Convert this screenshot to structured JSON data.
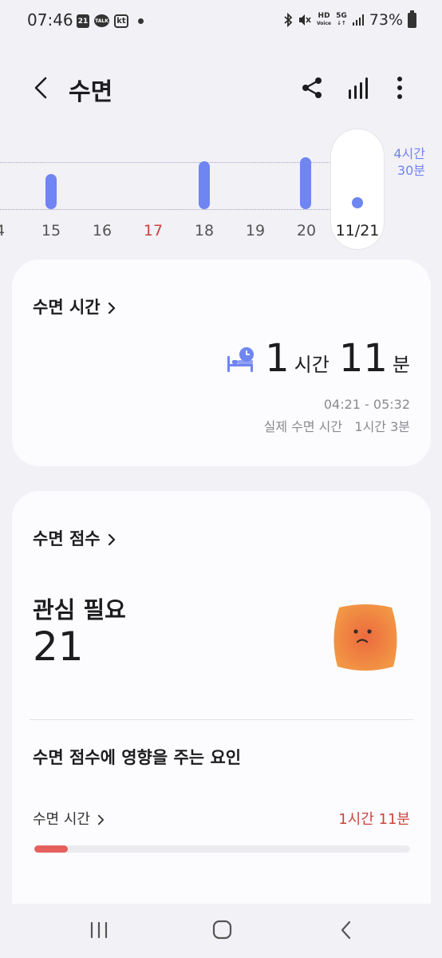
{
  "status_bar": {
    "time": "07:46",
    "calendar_badge": "21",
    "talk_badge": "TALK",
    "kt_badge": "kt",
    "hd_label": "HD",
    "voice_label": "Voice",
    "network": "5G",
    "battery": "73%",
    "icons": [
      "bluetooth-icon",
      "mute-icon",
      "signal-icon",
      "battery-icon"
    ]
  },
  "header": {
    "title": "수면",
    "icons": [
      "back-icon",
      "share-icon",
      "chart-icon",
      "more-icon"
    ]
  },
  "timeline": {
    "days": [
      {
        "label": "4",
        "sunday": false
      },
      {
        "label": "15",
        "sunday": false
      },
      {
        "label": "16",
        "sunday": false
      },
      {
        "label": "17",
        "sunday": true
      },
      {
        "label": "18",
        "sunday": false
      },
      {
        "label": "19",
        "sunday": false
      },
      {
        "label": "20",
        "sunday": false
      }
    ],
    "selected_day": "11/21",
    "goal_line1": "4시간",
    "goal_line2": "30분",
    "accent_color": "#6f85f2",
    "sunday_color": "#c9453c"
  },
  "sleep_time_card": {
    "title": "수면 시간",
    "hours": "1",
    "hours_unit": "시간",
    "minutes": "11",
    "minutes_unit": "분",
    "range": "04:21 - 05:32",
    "actual_label": "실제 수면 시간",
    "actual_value": "1시간 3분",
    "icon": "bed-clock-icon"
  },
  "score_card": {
    "title": "수면 점수",
    "status": "관심 필요",
    "score": "21",
    "mascot": "sad-face-icon",
    "factors_title": "수면 점수에 영향을 주는 요인",
    "factor_label": "수면 시간",
    "factor_value": "1시간 11분",
    "factor_progress_fraction": 0.09,
    "factor_color": "#e4605d"
  },
  "nav_bar": {
    "icons": [
      "recent-apps-icon",
      "home-icon",
      "nav-back-icon"
    ]
  }
}
